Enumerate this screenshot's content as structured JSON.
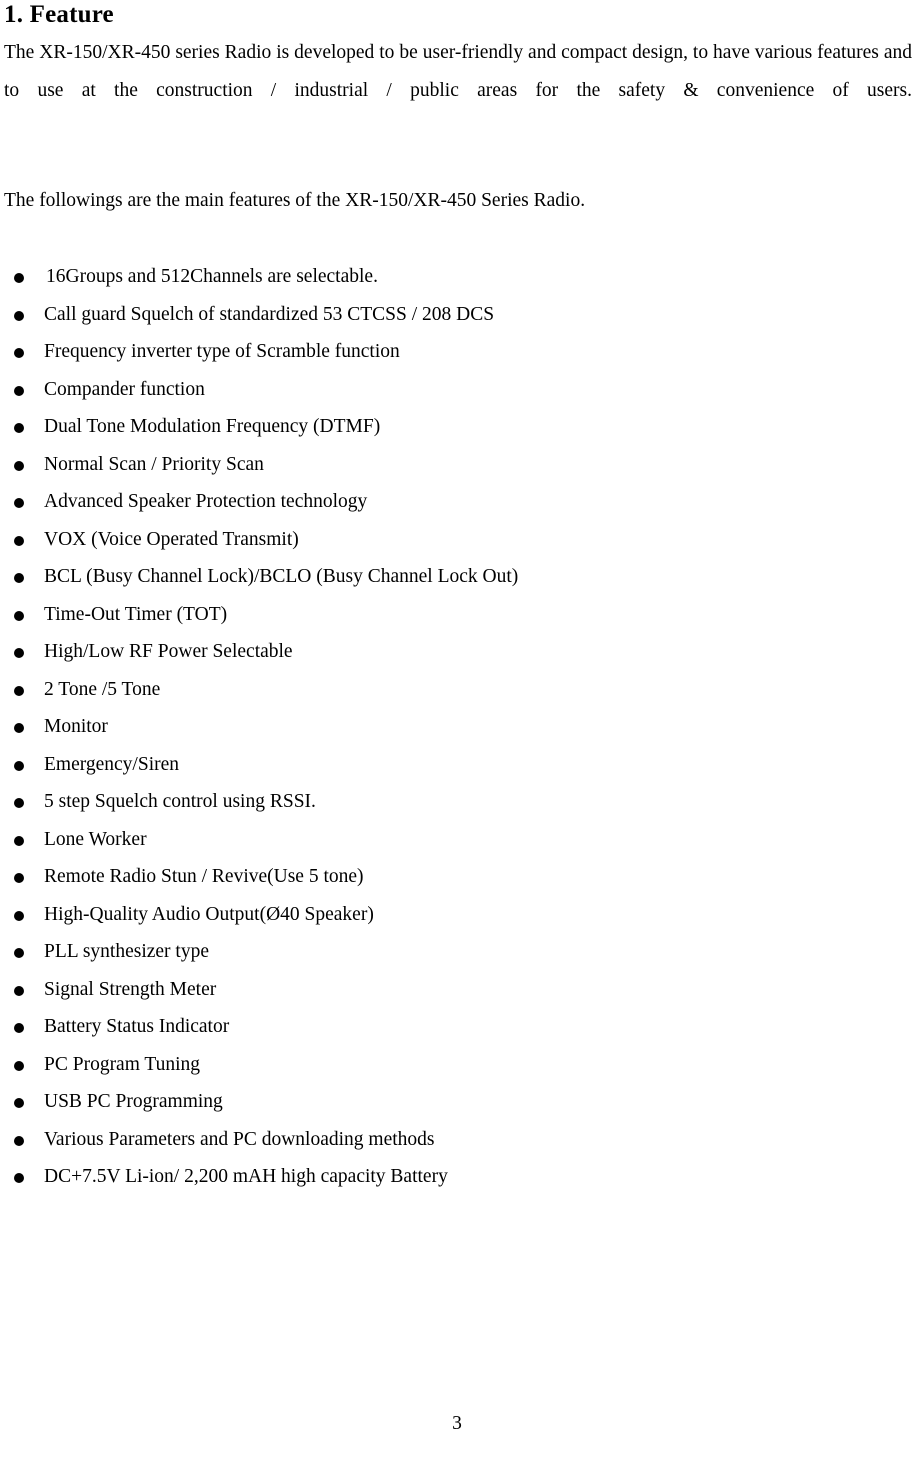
{
  "document": {
    "section_heading": "1. Feature",
    "intro_paragraph": "The XR-150/XR-450 series Radio is developed to be user-friendly and compact design, to have various features and to use at the construction / industrial / public areas for the safety & convenience of users.",
    "lead_in": "The followings are the main features of the XR-150/XR-450 Series Radio.",
    "bullet_icon": "filled-circle-bullet",
    "features": [
      "16Groups and 512Channels are selectable.",
      "Call guard Squelch of standardized 53 CTCSS / 208 DCS",
      "Frequency inverter type of Scramble function",
      "Compander function",
      "Dual Tone Modulation Frequency (DTMF)",
      "Normal Scan / Priority Scan",
      "Advanced Speaker Protection technology",
      "VOX (Voice Operated Transmit)",
      "BCL (Busy Channel Lock)/BCLO (Busy Channel Lock Out)",
      "Time-Out Timer (TOT)",
      "High/Low RF Power Selectable",
      "2 Tone /5 Tone",
      "Monitor",
      "Emergency/Siren",
      "5 step Squelch control using RSSI.",
      "Lone Worker",
      "Remote Radio Stun / Revive(Use 5 tone)",
      "High-Quality Audio Output(Ø40 Speaker)",
      "PLL synthesizer type",
      "Signal Strength Meter",
      "Battery Status Indicator",
      "PC Program Tuning",
      "USB PC Programming",
      "Various Parameters and PC downloading methods",
      "DC+7.5V Li-ion/ 2,200 mAH high capacity Battery"
    ],
    "page_number": "3"
  }
}
